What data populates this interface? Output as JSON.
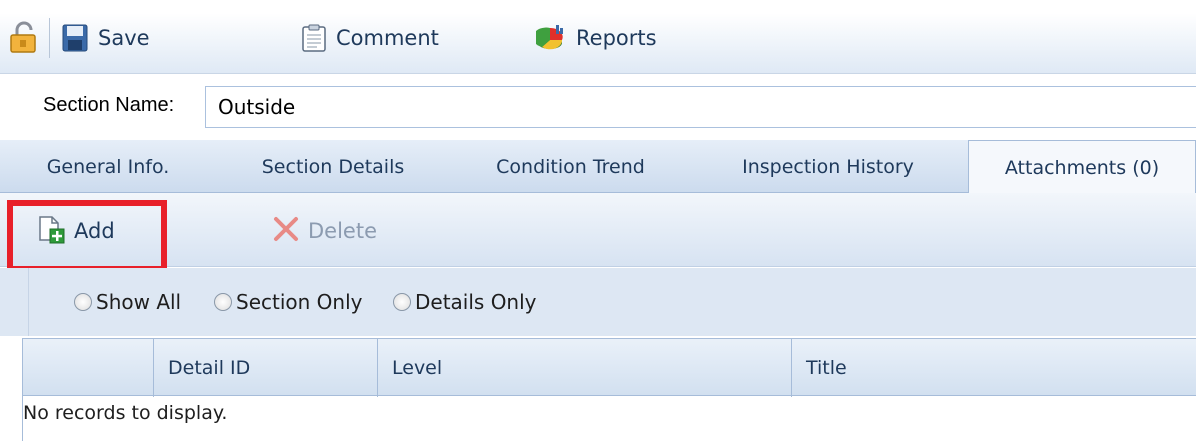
{
  "toolbar": {
    "save_label": "Save",
    "comment_label": "Comment",
    "reports_label": "Reports"
  },
  "section": {
    "label": "Section Name:",
    "value": "Outside"
  },
  "tabs": [
    {
      "label": "General Info."
    },
    {
      "label": "Section Details"
    },
    {
      "label": "Condition Trend"
    },
    {
      "label": "Inspection History"
    },
    {
      "label": "Attachments (0)",
      "active": true
    }
  ],
  "attachments_toolbar": {
    "add_label": "Add",
    "delete_label": "Delete"
  },
  "filters": [
    {
      "label": "Show All"
    },
    {
      "label": "Section Only"
    },
    {
      "label": "Details Only"
    }
  ],
  "grid": {
    "columns": [
      "Detail ID",
      "Level",
      "Title"
    ],
    "empty_text": "No records to display."
  },
  "colors": {
    "accent_highlight": "#e8202a",
    "text": "#1e395b",
    "tab_bar": "#ccdbee"
  }
}
